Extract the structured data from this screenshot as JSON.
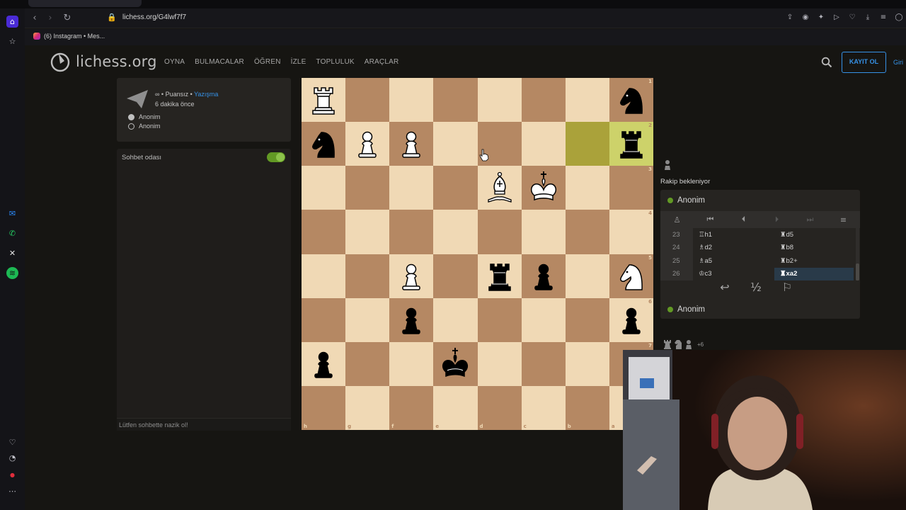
{
  "browser": {
    "url": "lichess.org/G4lwf7f7",
    "bookmark_label": "(6) Instagram • Mes..."
  },
  "header": {
    "logo_text": "lichess.org",
    "nav": [
      "OYNA",
      "BULMACALAR",
      "ÖĞREN",
      "İZLE",
      "TOPLULUK",
      "ARAÇLAR"
    ],
    "signup_label": "KAYIT OL",
    "signin_label": "Giri"
  },
  "game_meta": {
    "rated": "∞ • Puansız • ",
    "mode_link": "Yazışma",
    "time_ago": "6 dakika önce",
    "white_player": "Anonim",
    "black_player": "Anonim"
  },
  "chat": {
    "title": "Sohbet odası",
    "enabled": true,
    "placeholder": "Lütfen sohbette nazik ol!"
  },
  "board": {
    "orientation": "black",
    "ranks_shown": [
      "1",
      "2",
      "3",
      "4",
      "5",
      "6",
      "7"
    ],
    "files_shown": [
      "h",
      "g",
      "f",
      "e",
      "d",
      "c",
      "b",
      "a"
    ],
    "last_move_from": "b2",
    "last_move_to": "a2",
    "pieces": [
      {
        "square": "h1",
        "piece": "wR"
      },
      {
        "square": "a1",
        "piece": "bN"
      },
      {
        "square": "h2",
        "piece": "bN"
      },
      {
        "square": "g2",
        "piece": "wP"
      },
      {
        "square": "f2",
        "piece": "wP"
      },
      {
        "square": "a2",
        "piece": "bR"
      },
      {
        "square": "d3",
        "piece": "wB"
      },
      {
        "square": "c3",
        "piece": "wK"
      },
      {
        "square": "f5",
        "piece": "wP"
      },
      {
        "square": "d5",
        "piece": "bR"
      },
      {
        "square": "c5",
        "piece": "bP"
      },
      {
        "square": "a5",
        "piece": "wN"
      },
      {
        "square": "f6",
        "piece": "bP"
      },
      {
        "square": "a6",
        "piece": "bP"
      },
      {
        "square": "h7",
        "piece": "bP"
      },
      {
        "square": "e7",
        "piece": "bK"
      }
    ]
  },
  "status": {
    "waiting": "Rakip bekleniyor"
  },
  "players": {
    "top": "Anonim",
    "bottom": "Anonim"
  },
  "moves": [
    {
      "no": "23",
      "white": "♖h1",
      "black": "♜d5"
    },
    {
      "no": "24",
      "white": "♗d2",
      "black": "♜b8"
    },
    {
      "no": "25",
      "white": "♗a5",
      "black": "♜b2+"
    },
    {
      "no": "26",
      "white": "♔c3",
      "black": "♜xa2",
      "active": "black"
    }
  ],
  "captured_bottom": {
    "material": "+6"
  },
  "icons": {
    "back": "arrow-back-icon",
    "draw": "½",
    "resign": "flag-icon"
  }
}
